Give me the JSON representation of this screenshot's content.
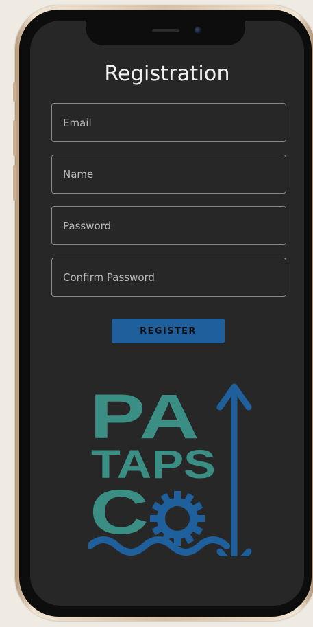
{
  "form": {
    "title": "Registration",
    "fields": [
      {
        "placeholder": "Email",
        "value": ""
      },
      {
        "placeholder": "Name",
        "value": ""
      },
      {
        "placeholder": "Password",
        "value": ""
      },
      {
        "placeholder": "Confirm Password",
        "value": ""
      }
    ],
    "register_label": "REGISTER"
  },
  "logo": {
    "line1": "PA",
    "line2": "TAPS",
    "line3": "CO",
    "colors": {
      "teal": "#3a8e84",
      "blue": "#1f5f9c"
    }
  },
  "theme": {
    "screen_bg": "#272727",
    "accent": "#1f5f9c",
    "frame": "#d7c0a4"
  }
}
